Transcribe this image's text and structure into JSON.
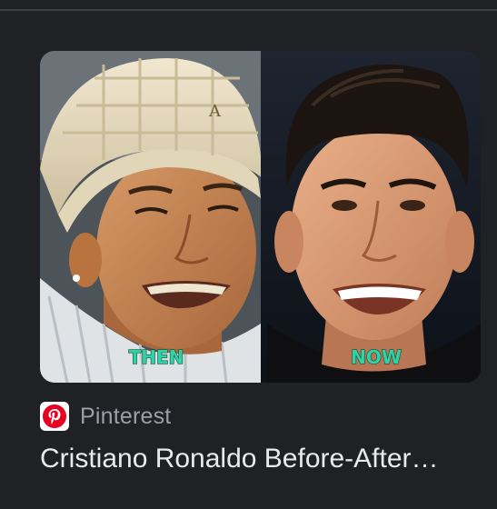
{
  "result": {
    "source_name": "Pinterest",
    "source_icon": "pinterest-logo-icon",
    "title": "Cristiano Ronaldo Before-After…",
    "image": {
      "left_caption": "THEN",
      "right_caption": "NOW",
      "caption_color": "#2fd3a6"
    }
  },
  "colors": {
    "background": "#202124",
    "title_text": "#e8eaed",
    "source_text": "#9aa0a6",
    "pinterest_red": "#e60023"
  }
}
